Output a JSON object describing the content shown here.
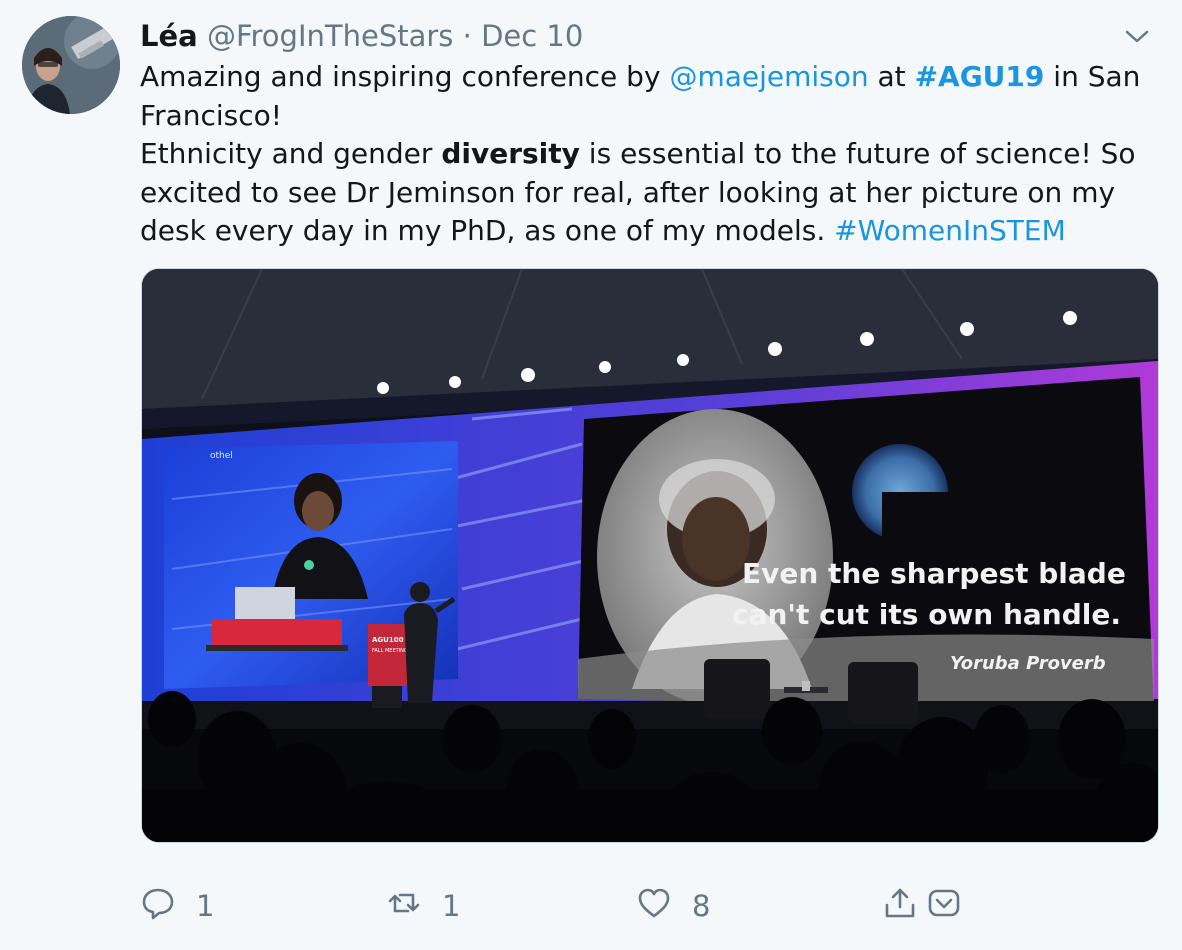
{
  "author": {
    "name": "Léa",
    "handle": "@FrogInTheStars",
    "separator": "·",
    "date": "Dec 10"
  },
  "tweet": {
    "line1_a": "Amazing and inspiring conference by ",
    "mention": "@maejemison",
    "line1_b": " at ",
    "hashtag_agu": "#AGU19",
    "line1_c": " in San Francisco!",
    "line2_a": "Ethnicity and gender ",
    "line2_bold": "diversity",
    "line2_b": " is essential to the future of science! So excited to see Dr Jeminson for real, after looking at her picture on my desk every day in my PhD, as one of my models. ",
    "hashtag_women": "#WomenInSTEM"
  },
  "media": {
    "slide_line1": "Even the sharpest blade",
    "slide_line2": "can't cut its own handle.",
    "slide_credit": "Yoruba Proverb",
    "podium_label": "AGU100",
    "podium_sub": "FALL MEETING"
  },
  "actions": {
    "reply_count": "1",
    "retweet_count": "1",
    "like_count": "8"
  },
  "icons": [
    "caret-down-icon",
    "reply-icon",
    "retweet-icon",
    "like-icon",
    "share-icon",
    "message-icon"
  ],
  "colors": {
    "link": "#1b95e0",
    "muted": "#657786",
    "background": "#f5f8fa"
  }
}
